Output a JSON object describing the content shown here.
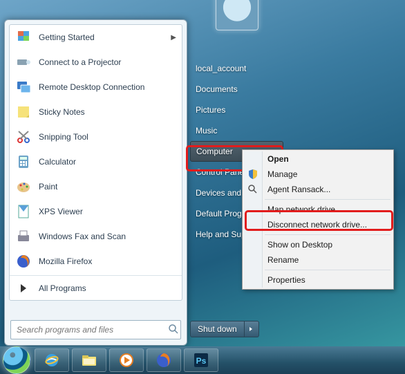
{
  "start_menu": {
    "programs": [
      {
        "id": "getting-started",
        "label": "Getting Started",
        "has_submenu": true,
        "icon": "flag"
      },
      {
        "id": "connect-projector",
        "label": "Connect to a Projector",
        "icon": "projector"
      },
      {
        "id": "remote-desktop",
        "label": "Remote Desktop Connection",
        "icon": "rdp"
      },
      {
        "id": "sticky-notes",
        "label": "Sticky Notes",
        "icon": "sticky"
      },
      {
        "id": "snipping-tool",
        "label": "Snipping Tool",
        "icon": "snip"
      },
      {
        "id": "calculator",
        "label": "Calculator",
        "icon": "calc"
      },
      {
        "id": "paint",
        "label": "Paint",
        "icon": "paint"
      },
      {
        "id": "xps-viewer",
        "label": "XPS Viewer",
        "icon": "xps"
      },
      {
        "id": "windows-fax-scan",
        "label": "Windows Fax and Scan",
        "icon": "fax"
      },
      {
        "id": "mozilla-firefox",
        "label": "Mozilla Firefox",
        "icon": "firefox"
      }
    ],
    "all_programs_label": "All Programs",
    "search_placeholder": "Search programs and files"
  },
  "right_column": {
    "user": "local_account",
    "items": [
      {
        "id": "documents",
        "label": "Documents"
      },
      {
        "id": "pictures",
        "label": "Pictures"
      },
      {
        "id": "music",
        "label": "Music"
      },
      {
        "id": "computer",
        "label": "Computer",
        "selected": true
      },
      {
        "id": "control-panel",
        "label": "Control Panel"
      },
      {
        "id": "devices-printers",
        "label": "Devices and Printers"
      },
      {
        "id": "default-programs",
        "label": "Default Programs"
      },
      {
        "id": "help-support",
        "label": "Help and Support"
      }
    ],
    "shutdown_label": "Shut down"
  },
  "context_menu": {
    "items": [
      {
        "id": "open",
        "label": "Open",
        "bold": true
      },
      {
        "id": "manage",
        "label": "Manage",
        "icon": "shield"
      },
      {
        "id": "agent-ransack",
        "label": "Agent Ransack...",
        "icon": "search"
      },
      {
        "sep": true
      },
      {
        "id": "map-network-drive",
        "label": "Map network drive...",
        "highlight": true
      },
      {
        "id": "disconnect-network-drive",
        "label": "Disconnect network drive..."
      },
      {
        "sep": true
      },
      {
        "id": "show-on-desktop",
        "label": "Show on Desktop"
      },
      {
        "id": "rename",
        "label": "Rename"
      },
      {
        "sep": true
      },
      {
        "id": "properties",
        "label": "Properties"
      }
    ]
  },
  "taskbar": {
    "buttons": [
      {
        "id": "ie",
        "name": "internet-explorer-icon"
      },
      {
        "id": "explorer",
        "name": "file-explorer-icon"
      },
      {
        "id": "wmp",
        "name": "media-player-icon"
      },
      {
        "id": "firefox",
        "name": "firefox-icon"
      },
      {
        "id": "photoshop",
        "name": "photoshop-icon"
      }
    ]
  },
  "highlight_color": "#e21c1c"
}
